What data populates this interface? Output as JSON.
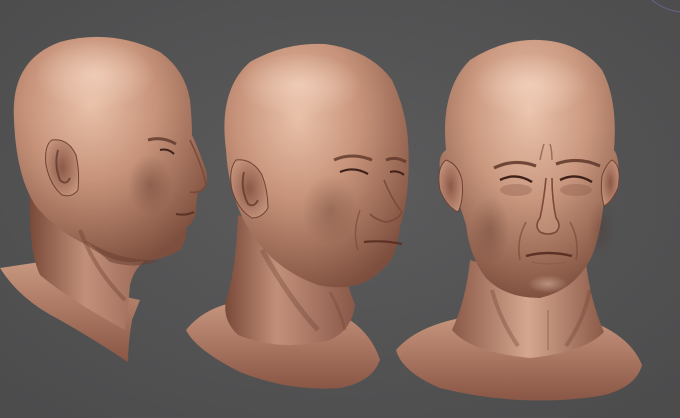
{
  "scene": {
    "background_color": "#555556",
    "skin_base_color": "#b9856e",
    "skin_highlight_color": "#e6bba3",
    "skin_shadow_color": "#5a3428",
    "views": [
      {
        "name": "head-side-view",
        "angle": "right profile"
      },
      {
        "name": "head-three-quarter-view",
        "angle": "three-quarter"
      },
      {
        "name": "head-front-view",
        "angle": "front"
      }
    ]
  }
}
